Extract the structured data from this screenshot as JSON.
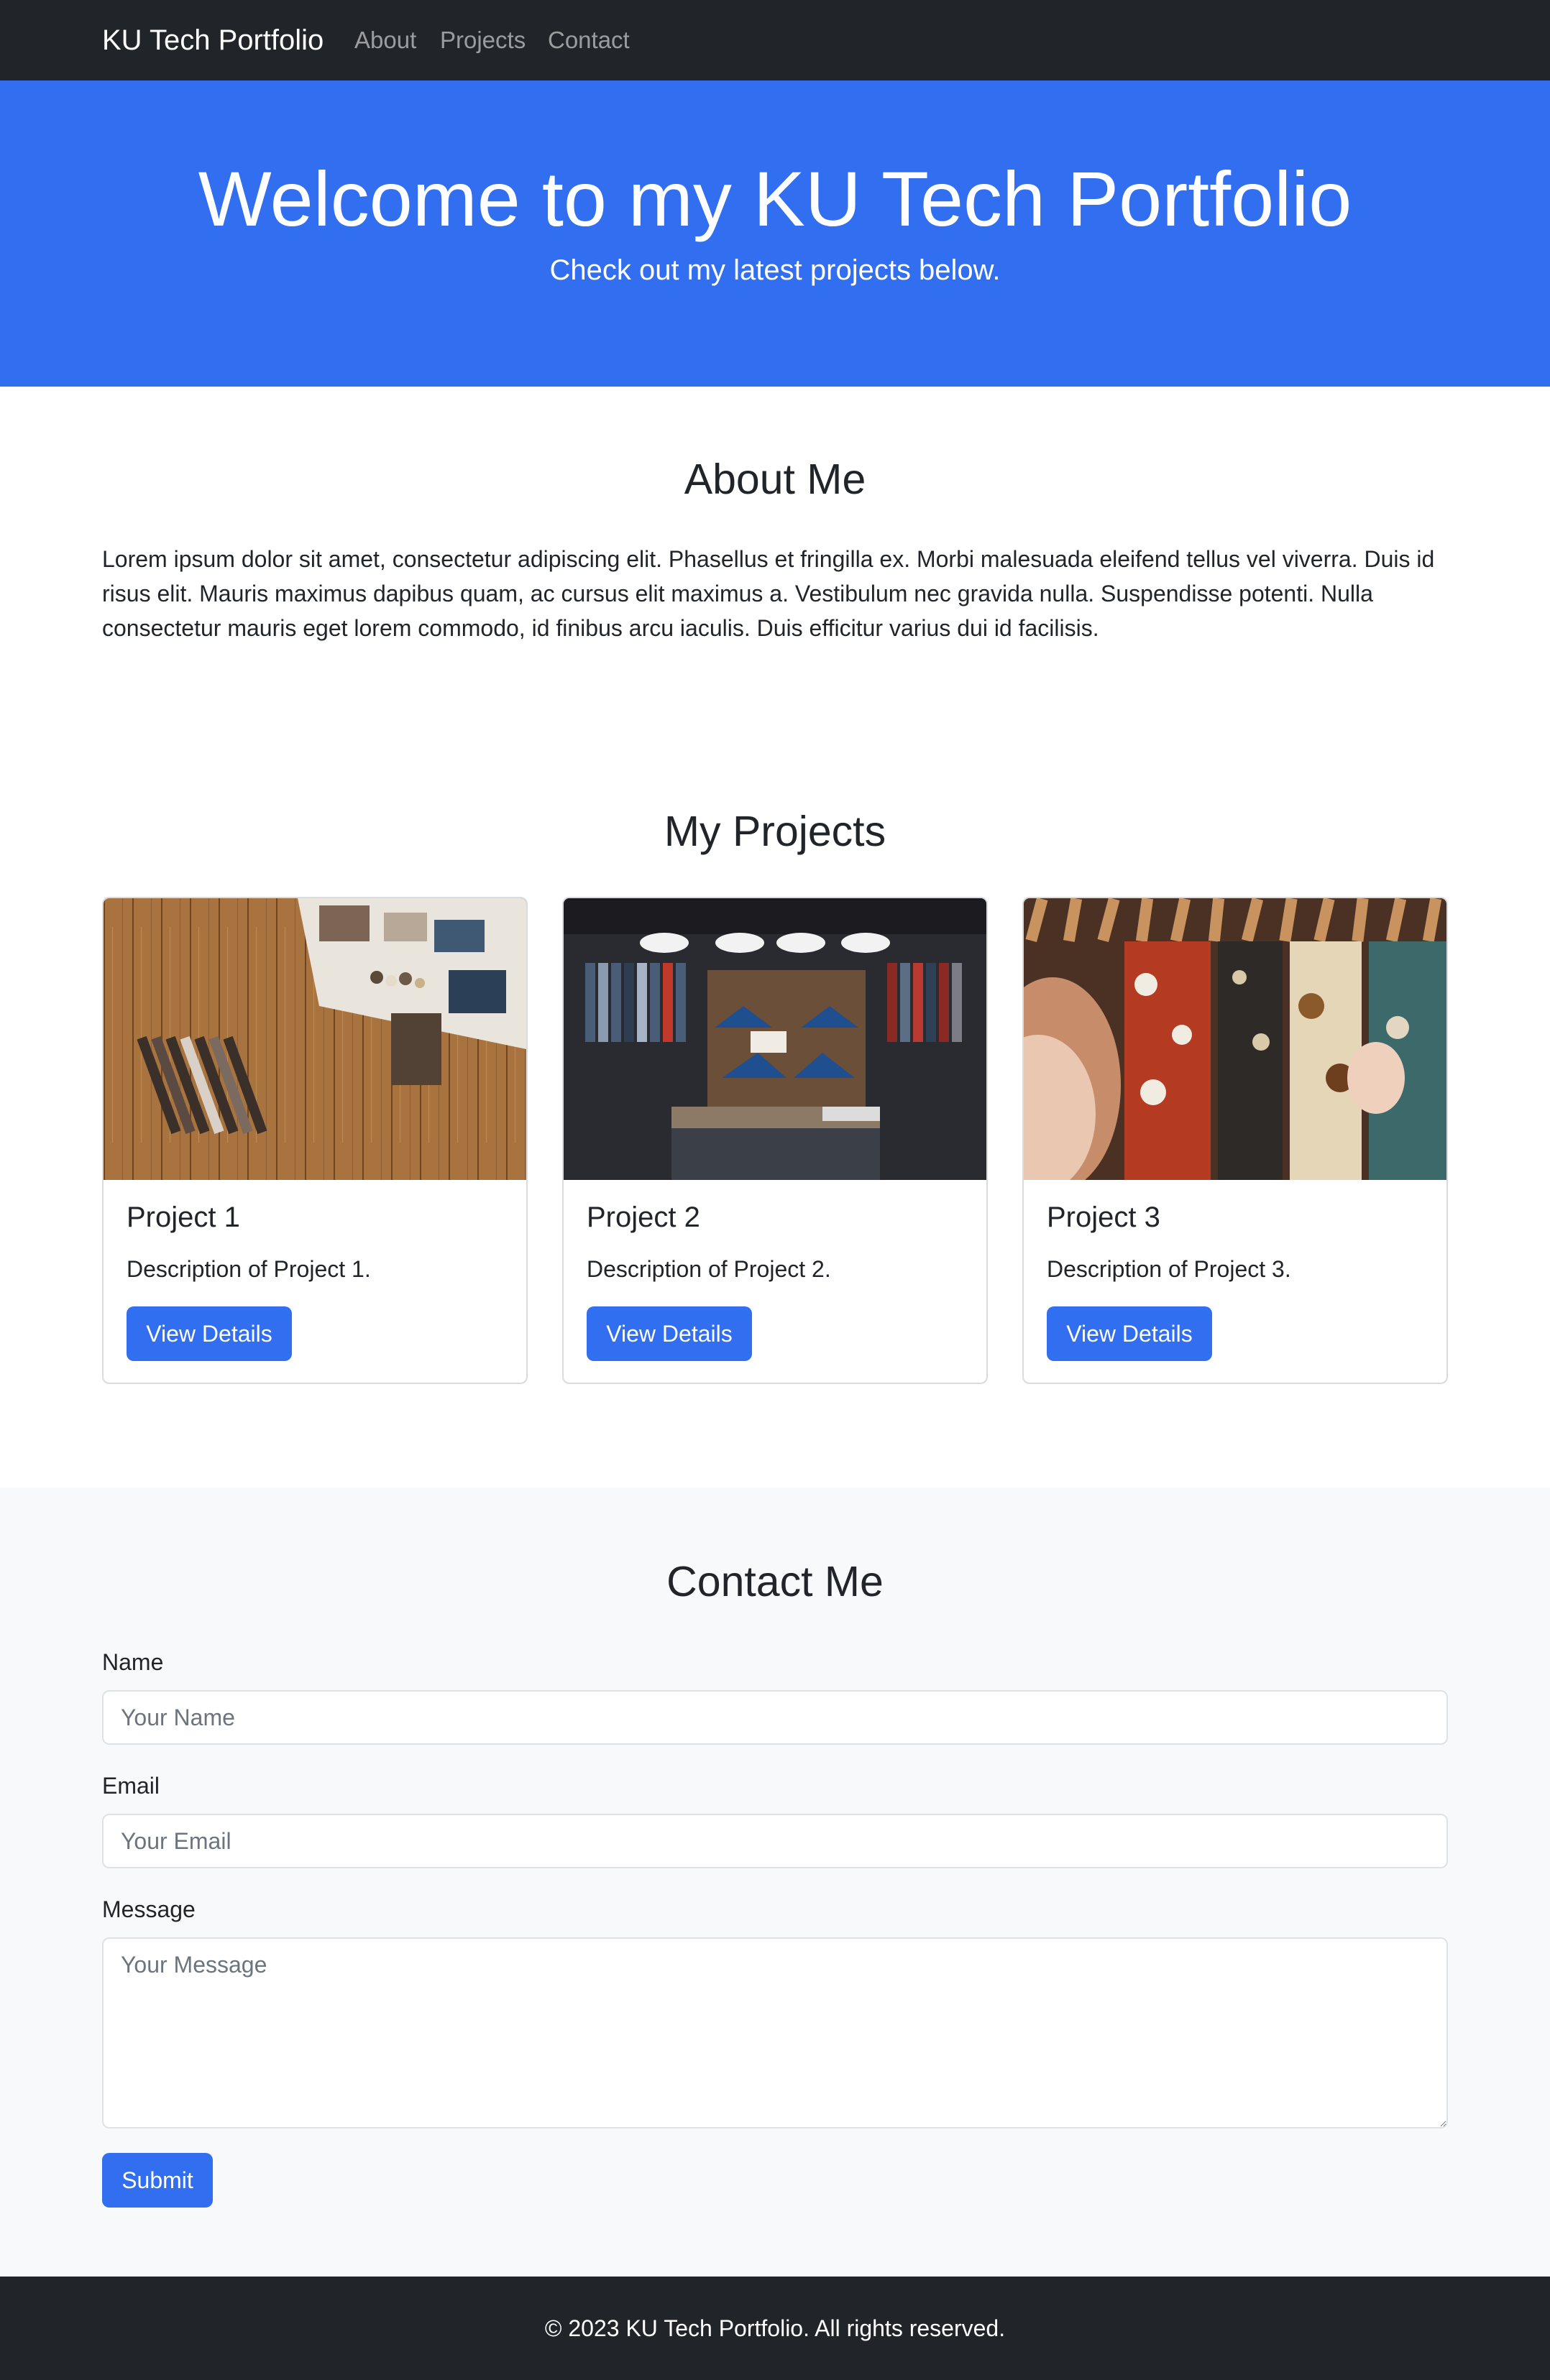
{
  "navbar": {
    "brand": "KU Tech Portfolio",
    "links": [
      "About",
      "Projects",
      "Contact"
    ]
  },
  "hero": {
    "title": "Welcome to my KU Tech Portfolio",
    "subtitle": "Check out my latest projects below."
  },
  "about": {
    "title": "About Me",
    "text": "Lorem ipsum dolor sit amet, consectetur adipiscing elit. Phasellus et fringilla ex. Morbi malesuada eleifend tellus vel viverra. Duis id risus elit. Mauris maximus dapibus quam, ac cursus elit maximus a. Vestibulum nec gravida nulla. Suspendisse potenti. Nulla consectetur mauris eget lorem commodo, id finibus arcu iaculis. Duis efficitur varius dui id facilisis."
  },
  "projects": {
    "title": "My Projects",
    "items": [
      {
        "title": "Project 1",
        "description": "Description of Project 1.",
        "button": "View Details"
      },
      {
        "title": "Project 2",
        "description": "Description of Project 2.",
        "button": "View Details"
      },
      {
        "title": "Project 3",
        "description": "Description of Project 3.",
        "button": "View Details"
      }
    ]
  },
  "contact": {
    "title": "Contact Me",
    "name_label": "Name",
    "name_placeholder": "Your Name",
    "email_label": "Email",
    "email_placeholder": "Your Email",
    "message_label": "Message",
    "message_placeholder": "Your Message",
    "submit": "Submit"
  },
  "footer": {
    "text": "© 2023 KU Tech Portfolio. All rights reserved."
  },
  "colors": {
    "primary": "#316ff0",
    "dark": "#212529",
    "light": "#f8f9fa"
  }
}
